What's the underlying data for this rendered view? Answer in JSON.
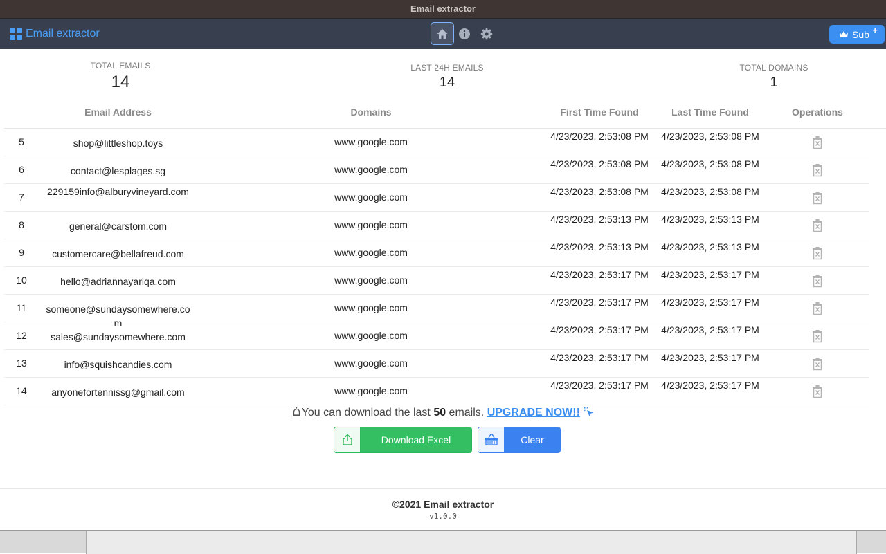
{
  "window": {
    "title": "Email extractor"
  },
  "header": {
    "brand": "Email extractor",
    "nav": [
      {
        "icon": "home-icon",
        "active": true
      },
      {
        "icon": "info-icon",
        "active": false
      },
      {
        "icon": "gear-icon",
        "active": false
      }
    ],
    "sub_label": "Sub",
    "sub_plus": "+"
  },
  "stats": {
    "total_emails_label": "TOTAL EMAILS",
    "total_emails": "14",
    "last24_label": "LAST 24H EMAILS",
    "last24": "14",
    "total_domains_label": "TOTAL DOMAINS",
    "total_domains": "1"
  },
  "table": {
    "headers": {
      "email": "Email Address",
      "domains": "Domains",
      "first": "First Time Found",
      "last": "Last Time Found",
      "ops": "Operations"
    },
    "rows": [
      {
        "idx": "5",
        "email": "shop@littleshop.toys",
        "domain": "www.google.com",
        "first": "4/23/2023, 2:53:08 PM",
        "last": "4/23/2023, 2:53:08 PM"
      },
      {
        "idx": "6",
        "email": "contact@lesplages.sg",
        "domain": "www.google.com",
        "first": "4/23/2023, 2:53:08 PM",
        "last": "4/23/2023, 2:53:08 PM"
      },
      {
        "idx": "7",
        "email": "229159info@alburyvineyard.com",
        "domain": "www.google.com",
        "first": "4/23/2023, 2:53:08 PM",
        "last": "4/23/2023, 2:53:08 PM"
      },
      {
        "idx": "8",
        "email": "general@carstom.com",
        "domain": "www.google.com",
        "first": "4/23/2023, 2:53:13 PM",
        "last": "4/23/2023, 2:53:13 PM"
      },
      {
        "idx": "9",
        "email": "customercare@bellafreud.com",
        "domain": "www.google.com",
        "first": "4/23/2023, 2:53:13 PM",
        "last": "4/23/2023, 2:53:13 PM"
      },
      {
        "idx": "10",
        "email": "hello@adriannayariqa.com",
        "domain": "www.google.com",
        "first": "4/23/2023, 2:53:17 PM",
        "last": "4/23/2023, 2:53:17 PM"
      },
      {
        "idx": "11",
        "email": "someone@sundaysomewhere.com",
        "domain": "www.google.com",
        "first": "4/23/2023, 2:53:17 PM",
        "last": "4/23/2023, 2:53:17 PM"
      },
      {
        "idx": "12",
        "email": "sales@sundaysomewhere.com",
        "domain": "www.google.com",
        "first": "4/23/2023, 2:53:17 PM",
        "last": "4/23/2023, 2:53:17 PM"
      },
      {
        "idx": "13",
        "email": "info@squishcandies.com",
        "domain": "www.google.com",
        "first": "4/23/2023, 2:53:17 PM",
        "last": "4/23/2023, 2:53:17 PM"
      },
      {
        "idx": "14",
        "email": "anyonefortennissg@gmail.com",
        "domain": "www.google.com",
        "first": "4/23/2023, 2:53:17 PM",
        "last": "4/23/2023, 2:53:17 PM"
      }
    ]
  },
  "notice": {
    "prefix": "You can download the last ",
    "count": "50",
    "suffix": " emails. ",
    "upgrade": "UPGRADE NOW!!"
  },
  "actions": {
    "download": "Download Excel",
    "clear": "Clear"
  },
  "footer": {
    "copyright": "©2021 Email extractor",
    "version": "v1.0.0"
  },
  "colors": {
    "accent": "#3b8ff0",
    "success": "#34c062",
    "topbar": "#38404f"
  }
}
